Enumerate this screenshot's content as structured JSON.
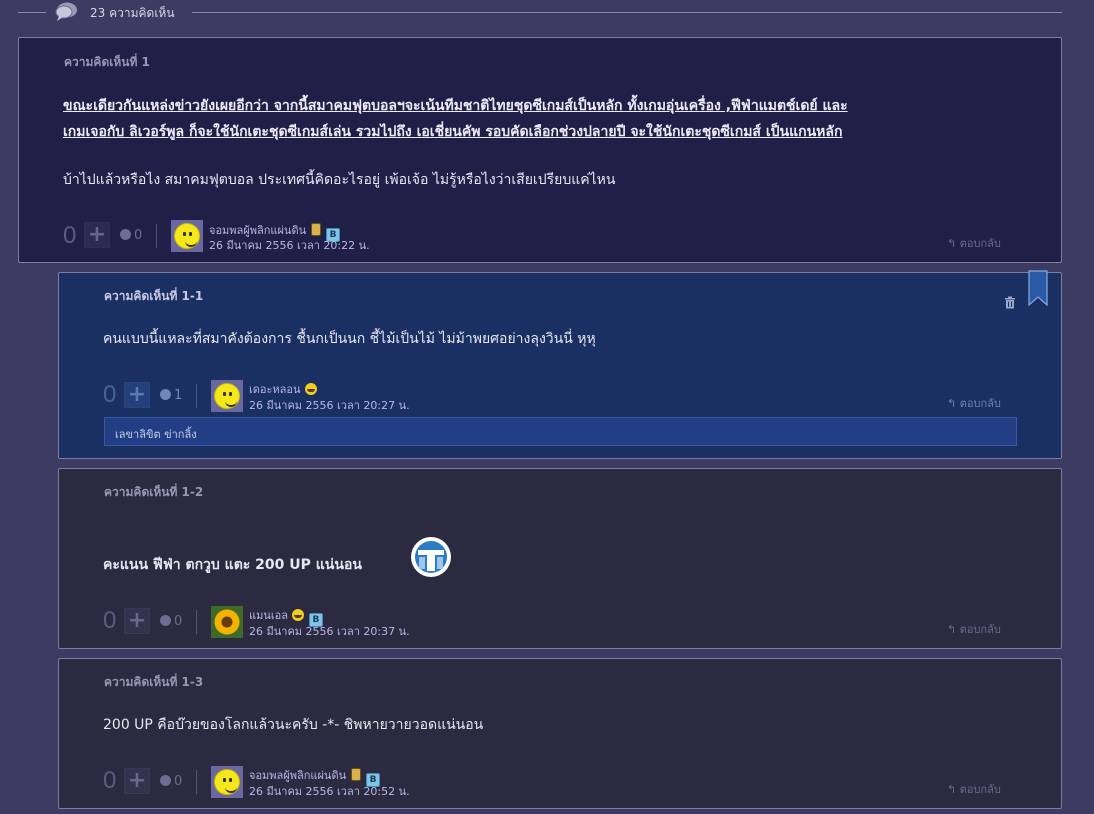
{
  "header": {
    "comment_count_label": "23 ความคิดเห็น",
    "icon": "speech-bubble-icon"
  },
  "colors": {
    "background": "#3e3b63",
    "main_card": "#201f47",
    "reply_highlight": "#1b3062",
    "reply_card": "#2c2a40",
    "link_text": "#b9b7e6"
  },
  "comments": [
    {
      "label": "ความคิดเห็นที่ 1",
      "quote_line1": "ขณะเดียวกันแหล่งข่าวยังเผยอีกว่า จากนี้สมาคมฟุตบอลฯจะเน้นทีมชาติไทยชุดซีเกมส์เป็นหลัก ทั้งเกมอุ่นเครื่อง ,ฟีฟ่าแมตช์เดย์ และ",
      "quote_line2": "เกมเจอกับ ลิเวอร์พูล ก็จะใช้นักเตะชุดซีเกมส์เล่น รวมไปถึง เอเชี่ยนคัพ รอบคัดเลือกช่วงปลายปี จะใช้นักเตะชุดซีเกมส์ เป็นแกนหลัก",
      "text": "บ้าไปแล้วหรือไง สมาคมฟุตบอล ประเทศนี้คิดอะไรอยู่ เพ้อเจ้อ ไม่รู้หรือไงว่าเสียเปรียบแค่ไหน",
      "votes": "0",
      "emotion_votes": "0",
      "user": "จอมพลผู้พลิกแผ่นดิน",
      "date": "26 มีนาคม 2556 เวลา 20:22 น.",
      "reply_label": "ตอบกลับ"
    },
    {
      "label": "ความคิดเห็นที่ 1-1",
      "text": "คนแบบนี้แหละที่สมาคังต้องการ ชื้นกเป็นนก ชี้ไม้เป็นไม้ ไม่ม้าพยศอย่างลุงวินนี่ หุหุ",
      "votes": "0",
      "emotion_votes": "1",
      "user": "เดอะหลอน",
      "date": "26 มีนาคม 2556 เวลา 20:27 น.",
      "reply_label": "ตอบกลับ",
      "sub_reply": "เลขาลิขิต ข่ากลิ้ง"
    },
    {
      "label": "ความคิดเห็นที่ 1-2",
      "text": "คะแนน ฟีฟ่า ตกวูบ  แตะ 200 UP แน่นอน",
      "votes": "0",
      "emotion_votes": "0",
      "user": "แมนเอล",
      "date": "26 มีนาคม 2556 เวลา 20:37 น.",
      "reply_label": "ตอบกลับ"
    },
    {
      "label": "ความคิดเห็นที่ 1-3",
      "text": "200 UP คือบ๊วยของโลกแล้วนะครับ -*- ชิพหายวายวอดแน่นอน",
      "votes": "0",
      "emotion_votes": "0",
      "user": "จอมพลผู้พลิกแผ่นดิน",
      "date": "26 มีนาคม 2556 เวลา 20:52 น.",
      "reply_label": "ตอบกลับ"
    }
  ],
  "icons": {
    "plus": "+",
    "reply": "↰",
    "badge_b": "B"
  }
}
